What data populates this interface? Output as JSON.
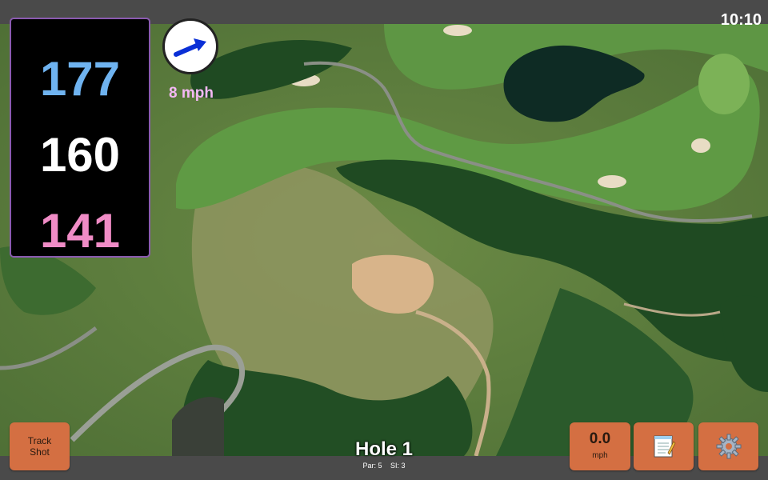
{
  "status": {
    "time": "10:10"
  },
  "distances": {
    "back": "177",
    "center": "160",
    "front": "141"
  },
  "wind": {
    "speed": "8 mph",
    "icon": "wind-arrow-icon"
  },
  "hole": {
    "title": "Hole 1",
    "par": "Par: 5",
    "stroke_index": "SI: 3"
  },
  "buttons": {
    "track_line1": "Track",
    "track_line2": "Shot",
    "speed_value": "0.0",
    "speed_unit": "mph",
    "notes_icon": "notepad-icon",
    "settings_icon": "gear-icon"
  },
  "colors": {
    "accent_button": "#d46f42",
    "back_distance": "#6fb3f0",
    "front_distance": "#f08cc6",
    "wind_text": "#f4b8f4"
  }
}
